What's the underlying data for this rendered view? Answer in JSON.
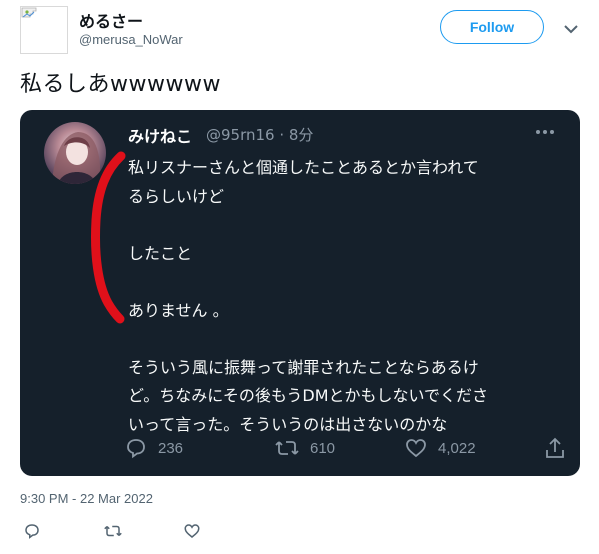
{
  "tweet": {
    "author_name": "めるさー",
    "author_handle": "@merusa_NoWar",
    "follow_label": "Follow",
    "text": "私るしあwwwwww",
    "timestamp": "9:30 PM - 22 Mar 2022"
  },
  "quote": {
    "author_name": "みけねこ",
    "handle_time": "@95rn16 · 8分",
    "paragraphs": [
      "私リスナーさんと個通したことあるとか言われて\nるらしいけど",
      "したこと",
      "ありません 。",
      "そういう風に振舞って謝罪されたことならあるけ\nど。ちなみにその後もうDMとかもしないでくださ\nいって言った。そういうのは出さないのかな"
    ],
    "replies": "236",
    "retweets": "610",
    "likes": "4,022"
  },
  "colors": {
    "accent": "#1d9bf0",
    "card_bg": "#15202b",
    "highlight_mark": "#e0101a"
  }
}
